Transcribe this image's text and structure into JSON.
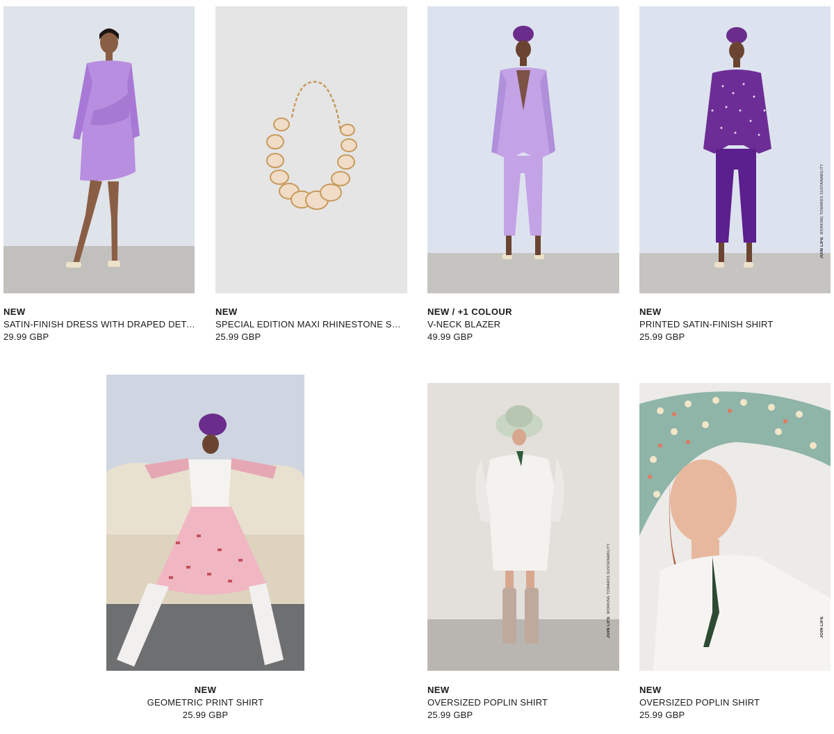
{
  "products": [
    {
      "badge": "NEW",
      "name": "SATIN-FINISH DRESS WITH DRAPED DETAIL",
      "price": "29.99 GBP",
      "image": "model-lilac-satin-dress"
    },
    {
      "badge": "NEW",
      "name": "SPECIAL EDITION MAXI RHINESTONE SEA…",
      "price": "25.99 GBP",
      "image": "rhinestone-shell-necklace"
    },
    {
      "badge": "NEW / +1 COLOUR",
      "name": "V-NECK BLAZER",
      "price": "49.99 GBP",
      "image": "model-lilac-suit-turban"
    },
    {
      "badge": "NEW",
      "name": "PRINTED SATIN-FINISH SHIRT",
      "price": "25.99 GBP",
      "image": "model-purple-polka-shirt",
      "tag": {
        "brand": "JOIN LIFE",
        "text": "WORKING TOWARDS SUSTAINABILITY"
      }
    },
    {
      "badge": "NEW",
      "name": "GEOMETRIC PRINT SHIRT",
      "price": "25.99 GBP",
      "image": "model-on-sofa-geometric-print"
    },
    {
      "badge": "NEW",
      "name": "OVERSIZED POPLIN SHIRT",
      "price": "25.99 GBP",
      "image": "model-white-shirt-snakeskin-boots",
      "tag": {
        "brand": "JOIN LIFE",
        "text": "WORKING TOWARDS SUSTAINABILITY"
      }
    },
    {
      "badge": "NEW",
      "name": "OVERSIZED POPLIN SHIRT",
      "price": "25.99 GBP",
      "image": "model-floral-bucket-hat-portrait",
      "tag": {
        "brand": "JOIN LIFE",
        "text": ""
      }
    }
  ],
  "colors": {
    "lilac": "#b58fe0",
    "purple": "#5a1f86",
    "backdrop": "#dde3ee",
    "floor": "#c4c2bf",
    "text": "#1a1a1a"
  }
}
